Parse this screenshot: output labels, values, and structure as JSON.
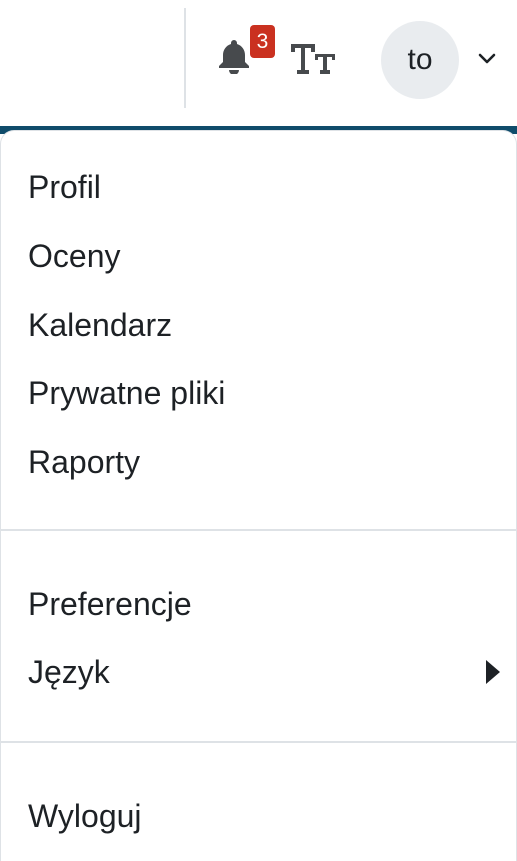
{
  "navbar": {
    "notifications": {
      "icon": "bell-icon",
      "count": "3",
      "badge_color": "#ca3120"
    },
    "text_size": {
      "icon": "text-size-icon"
    },
    "user": {
      "initials": "to",
      "menu_icon": "chevron-down-icon"
    }
  },
  "accent_color": "#0f4c6b",
  "user_menu": {
    "group1": [
      "Profil",
      "Oceny",
      "Kalendarz",
      "Prywatne pliki",
      "Raporty"
    ],
    "group2": {
      "preferences": "Preferencje",
      "language": "Język",
      "language_icon": "caret-right-icon"
    },
    "group3": {
      "logout": "Wyloguj"
    }
  }
}
